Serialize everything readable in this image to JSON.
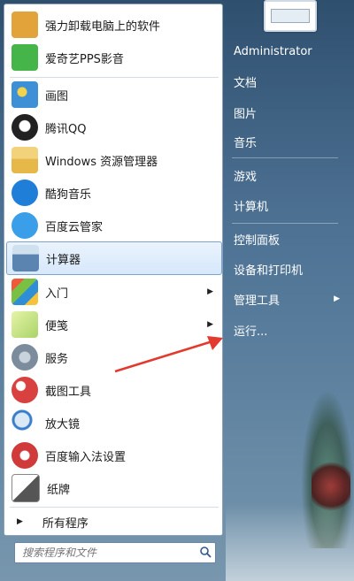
{
  "programs": [
    {
      "label": "强力卸载电脑上的软件",
      "icon": "uninstall-icon",
      "color": "#e2a33a"
    },
    {
      "label": "爱奇艺PPS影音",
      "icon": "iqiyi-icon",
      "color": "#46b549"
    },
    {
      "label": "画图",
      "icon": "paint-icon",
      "color": "#3d8fd6"
    },
    {
      "label": "腾讯QQ",
      "icon": "qq-icon",
      "color": "#222222"
    },
    {
      "label": "Windows 资源管理器",
      "icon": "explorer-icon",
      "color": "#e6b84a"
    },
    {
      "label": "酷狗音乐",
      "icon": "kugou-icon",
      "color": "#1f7ed8"
    },
    {
      "label": "百度云管家",
      "icon": "baidu-cloud-icon",
      "color": "#3a9ee8"
    },
    {
      "label": "计算器",
      "icon": "calculator-icon",
      "color": "#5b84b0"
    },
    {
      "label": "入门",
      "icon": "getting-started-icon",
      "color": "#4a9bd8",
      "submenu": true
    },
    {
      "label": "便笺",
      "icon": "sticky-notes-icon",
      "color": "#a8d468",
      "submenu": true
    },
    {
      "label": "服务",
      "icon": "services-icon",
      "color": "#7c8c9c"
    },
    {
      "label": "截图工具",
      "icon": "snipping-tool-icon",
      "color": "#d94040"
    },
    {
      "label": "放大镜",
      "icon": "magnifier-icon",
      "color": "#3a7dc9"
    },
    {
      "label": "百度输入法设置",
      "icon": "baidu-ime-settings-icon",
      "color": "#d03a3a"
    },
    {
      "label": "纸牌",
      "icon": "solitaire-icon",
      "color": "#555555"
    }
  ],
  "all_programs": "所有程序",
  "search": {
    "placeholder": "搜索程序和文件"
  },
  "right_column": [
    {
      "label": "Administrator"
    },
    {
      "label": "文档"
    },
    {
      "label": "图片"
    },
    {
      "label": "音乐"
    },
    {
      "label": "游戏"
    },
    {
      "label": "计算机"
    },
    {
      "label": "控制面板"
    },
    {
      "label": "设备和打印机"
    },
    {
      "label": "管理工具",
      "submenu": true
    },
    {
      "label": "运行..."
    }
  ],
  "annotation": {
    "arrow_color": "#e23a2e"
  },
  "colors": {
    "selection_border": "#7da2ce",
    "panel_bg": "#ffffff"
  }
}
